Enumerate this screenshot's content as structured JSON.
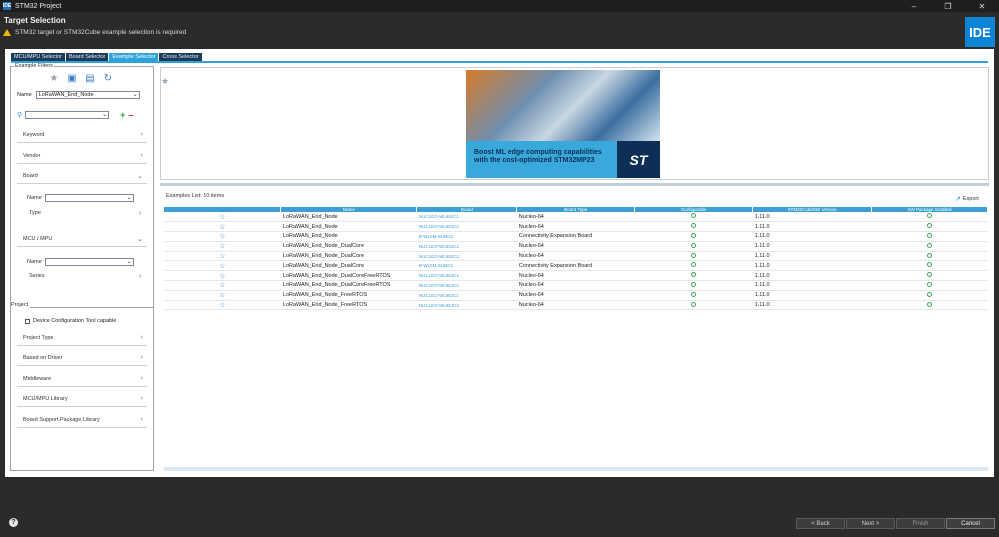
{
  "window": {
    "title": "STM32 Project",
    "app_icon_text": "IDE"
  },
  "header": {
    "title": "Target Selection",
    "warning": "STM32 target or STM32Cube example selection is required",
    "logo": "IDE"
  },
  "tabs": [
    {
      "label": "MCU/MPU Selector"
    },
    {
      "label": "Board Selector"
    },
    {
      "label": "Example Selector"
    },
    {
      "label": "Cross Selector"
    }
  ],
  "filters": {
    "title": "Example Filters",
    "name_label": "Name",
    "name_value": "LoRaWAN_End_Node",
    "search_value": "",
    "items": {
      "keyword": "Keyword",
      "vendor": "Vendor",
      "board": "Board",
      "board_name_label": "Name",
      "board_type_label": "Type",
      "mcu": "MCU / MPU",
      "mcu_name_label": "Name",
      "mcu_series_label": "Series"
    },
    "project": {
      "title": "Project",
      "device_config_label": "Device Configuration Tool capable",
      "project_type": "Project Type",
      "based_on_driver": "Based on Driver",
      "middleware": "Middleware",
      "mcu_mpu_library": "MCU/MPU Library",
      "bsp_library": "Board Support Package Library"
    }
  },
  "banner": {
    "text": "Boost ML edge computing capabilities with the cost-optimized STM32MP23",
    "logo": "ST"
  },
  "examples": {
    "list_label": "Examples List: 10 items",
    "export_label": "Export",
    "columns": [
      "Name",
      "Board",
      "Board Type",
      "Configurable",
      "STM32CubeIDE Version",
      "SW Package Installed"
    ],
    "rows": [
      {
        "name": "LoRaWAN_End_Node",
        "board": "NUCLEO-WL55JC1",
        "type": "Nucleo-64",
        "version": "1.11.0"
      },
      {
        "name": "LoRaWAN_End_Node",
        "board": "NUCLEO-WL55JC2",
        "type": "Nucleo-64",
        "version": "1.11.0"
      },
      {
        "name": "LoRaWAN_End_Node",
        "board": "B-WL5M-SUBG1",
        "type": "Connectivity Expansion Board",
        "version": "1.11.0"
      },
      {
        "name": "LoRaWAN_End_Node_DualCore",
        "board": "NUCLEO-WL55JC1",
        "type": "Nucleo-64",
        "version": "1.11.0"
      },
      {
        "name": "LoRaWAN_End_Node_DualCore",
        "board": "NUCLEO-WL55JC2",
        "type": "Nucleo-64",
        "version": "1.11.0"
      },
      {
        "name": "LoRaWAN_End_Node_DualCore",
        "board": "B-WL5M-SUBG1",
        "type": "Connectivity Expansion Board",
        "version": "1.11.0"
      },
      {
        "name": "LoRaWAN_End_Node_DualCoreFreeRTOS",
        "board": "NUCLEO-WL55JC1",
        "type": "Nucleo-64",
        "version": "1.11.0"
      },
      {
        "name": "LoRaWAN_End_Node_DualCoreFreeRTOS",
        "board": "NUCLEO-WL55JC2",
        "type": "Nucleo-64",
        "version": "1.11.0"
      },
      {
        "name": "LoRaWAN_End_Node_FreeRTOS",
        "board": "NUCLEO-WL55JC1",
        "type": "Nucleo-64",
        "version": "1.11.0"
      },
      {
        "name": "LoRaWAN_End_Node_FreeRTOS",
        "board": "NUCLEO-WL55JC2",
        "type": "Nucleo-64",
        "version": "1.11.0"
      }
    ]
  },
  "footer": {
    "help": "?",
    "back": "< Back",
    "next": "Next >",
    "finish": "Finish",
    "cancel": "Cancel"
  },
  "colors": {
    "accent": "#3a9fd6",
    "tab_dark": "#1d3a5a",
    "ok_green": "#3aa856",
    "warning": "#f2b800"
  }
}
